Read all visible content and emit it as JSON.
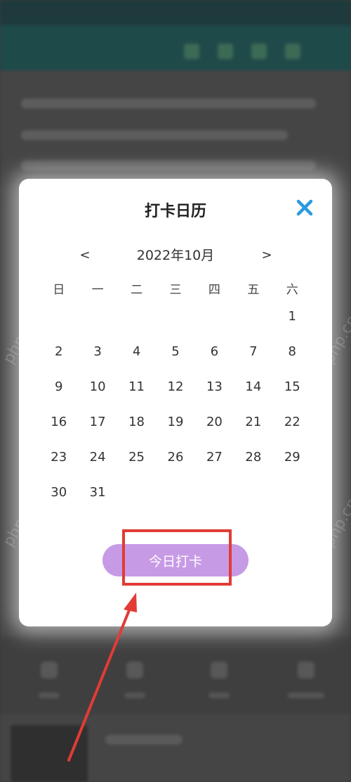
{
  "dialog": {
    "title": "打卡日历",
    "close_icon": "close-icon",
    "month": "2022年10月",
    "prev": "<",
    "next": ">",
    "weekdays": [
      "日",
      "一",
      "二",
      "三",
      "四",
      "五",
      "六"
    ],
    "days": [
      "",
      "",
      "",
      "",
      "",
      "",
      "1",
      "2",
      "3",
      "4",
      "5",
      "6",
      "7",
      "8",
      "9",
      "10",
      "11",
      "12",
      "13",
      "14",
      "15",
      "16",
      "17",
      "18",
      "19",
      "20",
      "21",
      "22",
      "23",
      "24",
      "25",
      "26",
      "27",
      "28",
      "29",
      "30",
      "31",
      "",
      "",
      "",
      "",
      ""
    ],
    "checkin_label": "今日打卡"
  },
  "colors": {
    "accent": "#c79ae6",
    "close": "#2b9be0",
    "annotation": "#e23b36"
  },
  "watermark": "php.cn"
}
